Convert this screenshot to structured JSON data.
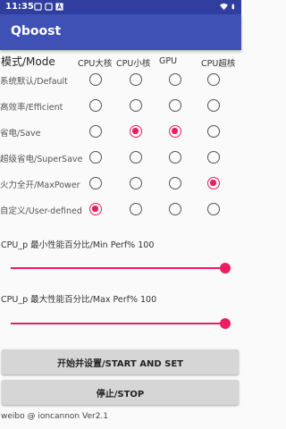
{
  "status_bar": {
    "time": "11:35",
    "icons": [
      "notification-icon",
      "notification-icon",
      "text-icon"
    ],
    "right_icons": [
      "wifi-icon",
      "battery-icon"
    ]
  },
  "app": {
    "title": "Qboost"
  },
  "mode_table": {
    "header_label": "模式/Mode",
    "columns": [
      "CPU大核",
      "CPU小核",
      "GPU",
      "CPU超核"
    ],
    "rows": [
      {
        "label": "系统默认/Default",
        "selected": [
          false,
          false,
          false,
          false
        ]
      },
      {
        "label": "高效率/Efficient",
        "selected": [
          false,
          false,
          false,
          false
        ]
      },
      {
        "label": "省电/Save",
        "selected": [
          false,
          true,
          true,
          false
        ]
      },
      {
        "label": "超级省电/SuperSave",
        "selected": [
          false,
          false,
          false,
          false
        ]
      },
      {
        "label": "火力全开/MaxPower",
        "selected": [
          false,
          false,
          false,
          true
        ]
      },
      {
        "label": "自定义/User-defined",
        "selected": [
          true,
          false,
          false,
          false
        ]
      }
    ]
  },
  "min_perf": {
    "label": "CPU_p 最小性能百分比/Min Perf% 100",
    "value": 100
  },
  "max_perf": {
    "label": "CPU_p 最大性能百分比/Max Perf% 100",
    "value": 100
  },
  "buttons": {
    "start": "开始并设置/START AND SET",
    "stop": "停止/STOP"
  },
  "footer": "weibo @ ioncannon Ver2.1",
  "colors": {
    "status_bar": "#303f9f",
    "app_bar": "#3f51b5",
    "accent": "#e91e63"
  }
}
